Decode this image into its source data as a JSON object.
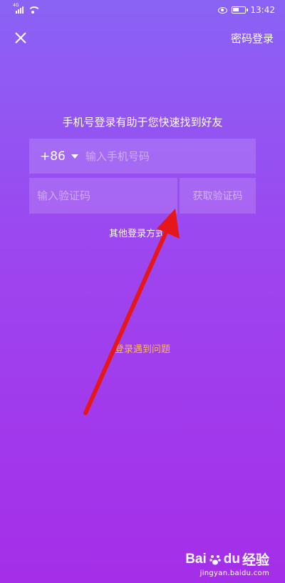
{
  "status_bar": {
    "network": "4G",
    "time": "13:42"
  },
  "header": {
    "password_login": "密码登录"
  },
  "subtitle": "手机号登录有助于您快速找到好友",
  "form": {
    "country_code": "+86",
    "phone_placeholder": "输入手机号码",
    "code_placeholder": "输入验证码",
    "get_code_label": "获取验证码"
  },
  "other_login": "其他登录方式",
  "trouble_link": "登录遇到问题",
  "watermark": {
    "brand": "Bai",
    "brand_mid": "du",
    "brand_cn": "经验",
    "url": "jingyan.baidu.com"
  },
  "colors": {
    "bg_top": "#8a63f5",
    "bg_bottom": "#a52ee8",
    "link_orange": "#ffb74a",
    "annotation_red": "#e5171b"
  }
}
